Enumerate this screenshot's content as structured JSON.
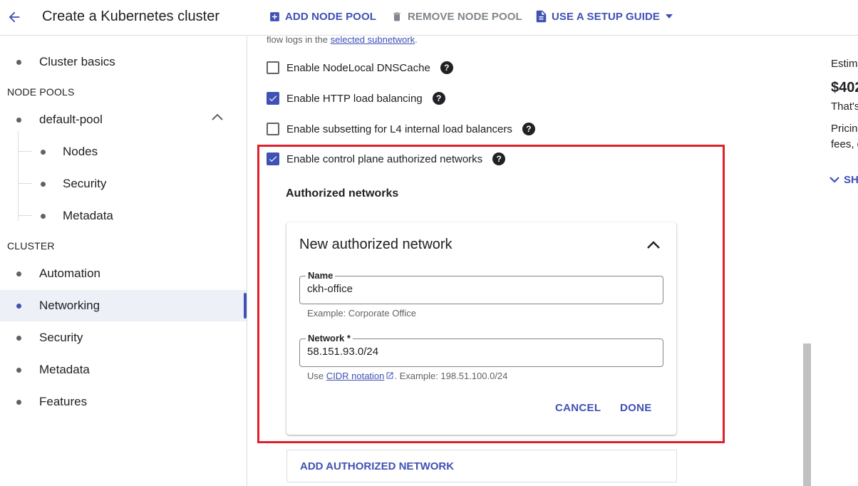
{
  "header": {
    "title": "Create a Kubernetes cluster",
    "add_node_pool": "ADD NODE POOL",
    "remove_node_pool": "REMOVE NODE POOL",
    "setup_guide": "USE A SETUP GUIDE"
  },
  "sidebar": {
    "cluster_basics": "Cluster basics",
    "node_pools_section": "NODE POOLS",
    "default_pool": "default-pool",
    "pool_children": [
      "Nodes",
      "Security",
      "Metadata"
    ],
    "cluster_section": "CLUSTER",
    "cluster_items": [
      "Automation",
      "Networking",
      "Security",
      "Metadata",
      "Features"
    ],
    "active_item": "Networking"
  },
  "main": {
    "flow_logs_prefix": "flow logs in the ",
    "flow_logs_link": "selected subnetwork",
    "flow_logs_suffix": ".",
    "checkboxes": [
      {
        "label": "Enable NodeLocal DNSCache",
        "checked": false
      },
      {
        "label": "Enable HTTP load balancing",
        "checked": true
      },
      {
        "label": "Enable subsetting for L4 internal load balancers",
        "checked": false
      },
      {
        "label": "Enable control plane authorized networks",
        "checked": true
      }
    ],
    "authorized_networks_title": "Authorized networks",
    "card": {
      "title": "New authorized network",
      "name_label": "Name",
      "name_value": "ckh-office",
      "name_hint": "Example: Corporate Office",
      "network_label": "Network *",
      "network_value": "58.151.93.0/24",
      "network_hint_prefix": "Use ",
      "network_hint_link": "CIDR notation",
      "network_hint_suffix": ". Example: 198.51.100.0/24",
      "cancel": "CANCEL",
      "done": "DONE"
    },
    "add_authorized_network": "ADD AUTHORIZED NETWORK"
  },
  "right_panel": {
    "estimate_label": "Estim",
    "price": "$402",
    "thats": "That's",
    "pricing": "Pricin",
    "fees": "fees, d",
    "show": "SH"
  },
  "colors": {
    "accent": "#3f51b5",
    "highlight": "#e0202b"
  },
  "icons": {
    "back": "arrow-left-icon",
    "add": "add-box-icon",
    "delete": "trash-icon",
    "doc": "document-icon",
    "dropdown": "caret-down-icon",
    "help": "help-circle-icon",
    "collapse": "chevron-up-icon",
    "external": "open-in-new-icon",
    "expand": "chevron-down-icon"
  }
}
